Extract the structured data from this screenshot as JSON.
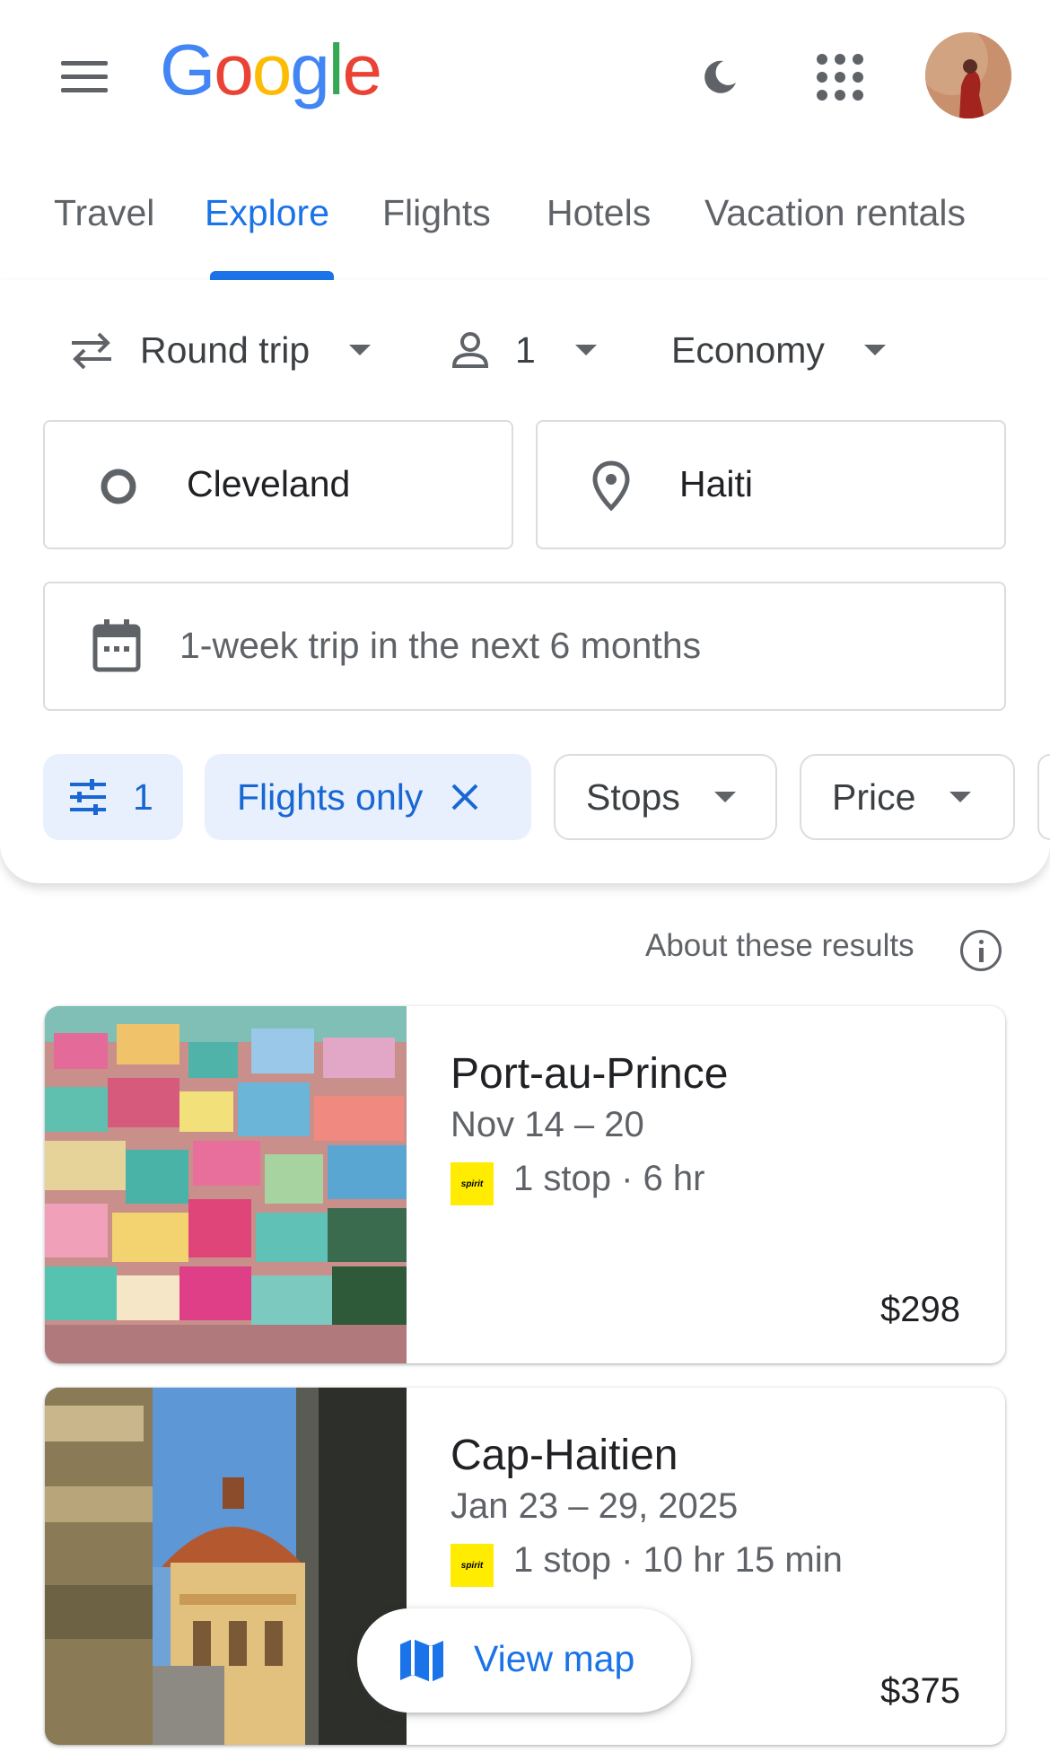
{
  "header": {
    "logo": [
      "G",
      "o",
      "o",
      "g",
      "l",
      "e"
    ]
  },
  "tabs": [
    "Travel",
    "Explore",
    "Flights",
    "Hotels",
    "Vacation rentals"
  ],
  "search": {
    "trip_type": "Round trip",
    "passengers": "1",
    "cabin": "Economy",
    "origin": "Cleveland",
    "destination": "Haiti",
    "dates": "1-week trip in the next 6 months"
  },
  "filters": {
    "all_filters_count": "1",
    "flights_only": "Flights only",
    "stops": "Stops",
    "price": "Price"
  },
  "results": {
    "about": "About these results",
    "items": [
      {
        "city": "Port-au-Prince",
        "dates": "Nov 14 – 20",
        "airline": "spirit",
        "stops": "1 stop · 6 hr",
        "price": "$298"
      },
      {
        "city": "Cap-Haitien",
        "dates": "Jan 23 – 29, 2025",
        "airline": "spirit",
        "stops": "1 stop · 10 hr 15 min",
        "price": "$375"
      }
    ]
  },
  "view_map": "View map",
  "colors": {
    "accent": "#1a73e8",
    "chip_bg": "#e8f0fe",
    "spirit_yellow": "#ffec00"
  }
}
